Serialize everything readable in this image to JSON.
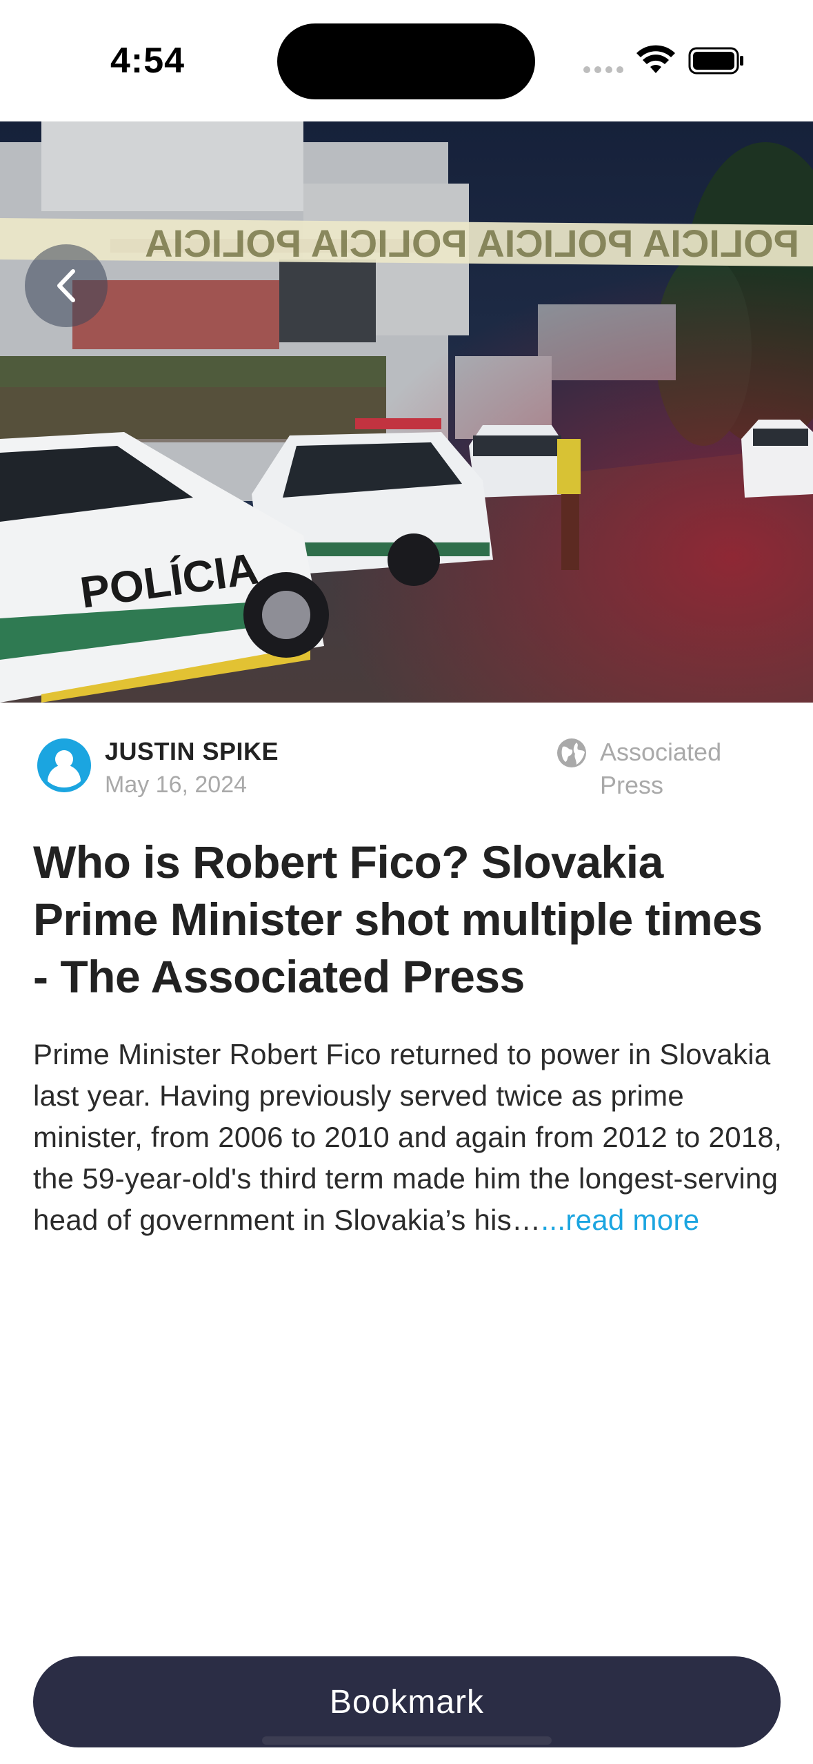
{
  "status_bar": {
    "time": "4:54"
  },
  "hero": {
    "tape_text": "POLICIA",
    "car_text": "POLÍCIA",
    "back_icon": "chevron-left-icon"
  },
  "article": {
    "author": "JUSTIN SPIKE",
    "date": "May 16, 2024",
    "source": "Associated Press",
    "headline": "Who is Robert Fico? Slovakia Prime Minister shot multiple times - The Associated Press",
    "summary": "Prime Minister Robert Fico returned to power in Slovakia last year. Having previously served twice as prime minister, from 2006 to 2010 and again from 2012 to 2018, the 59-year-old's third term made him the longest-serving head of government in Slovakia’s his…",
    "read_more": "...read more"
  },
  "actions": {
    "bookmark_label": "Bookmark"
  },
  "colors": {
    "accent": "#1ba5e0",
    "button": "#2b2d45"
  }
}
